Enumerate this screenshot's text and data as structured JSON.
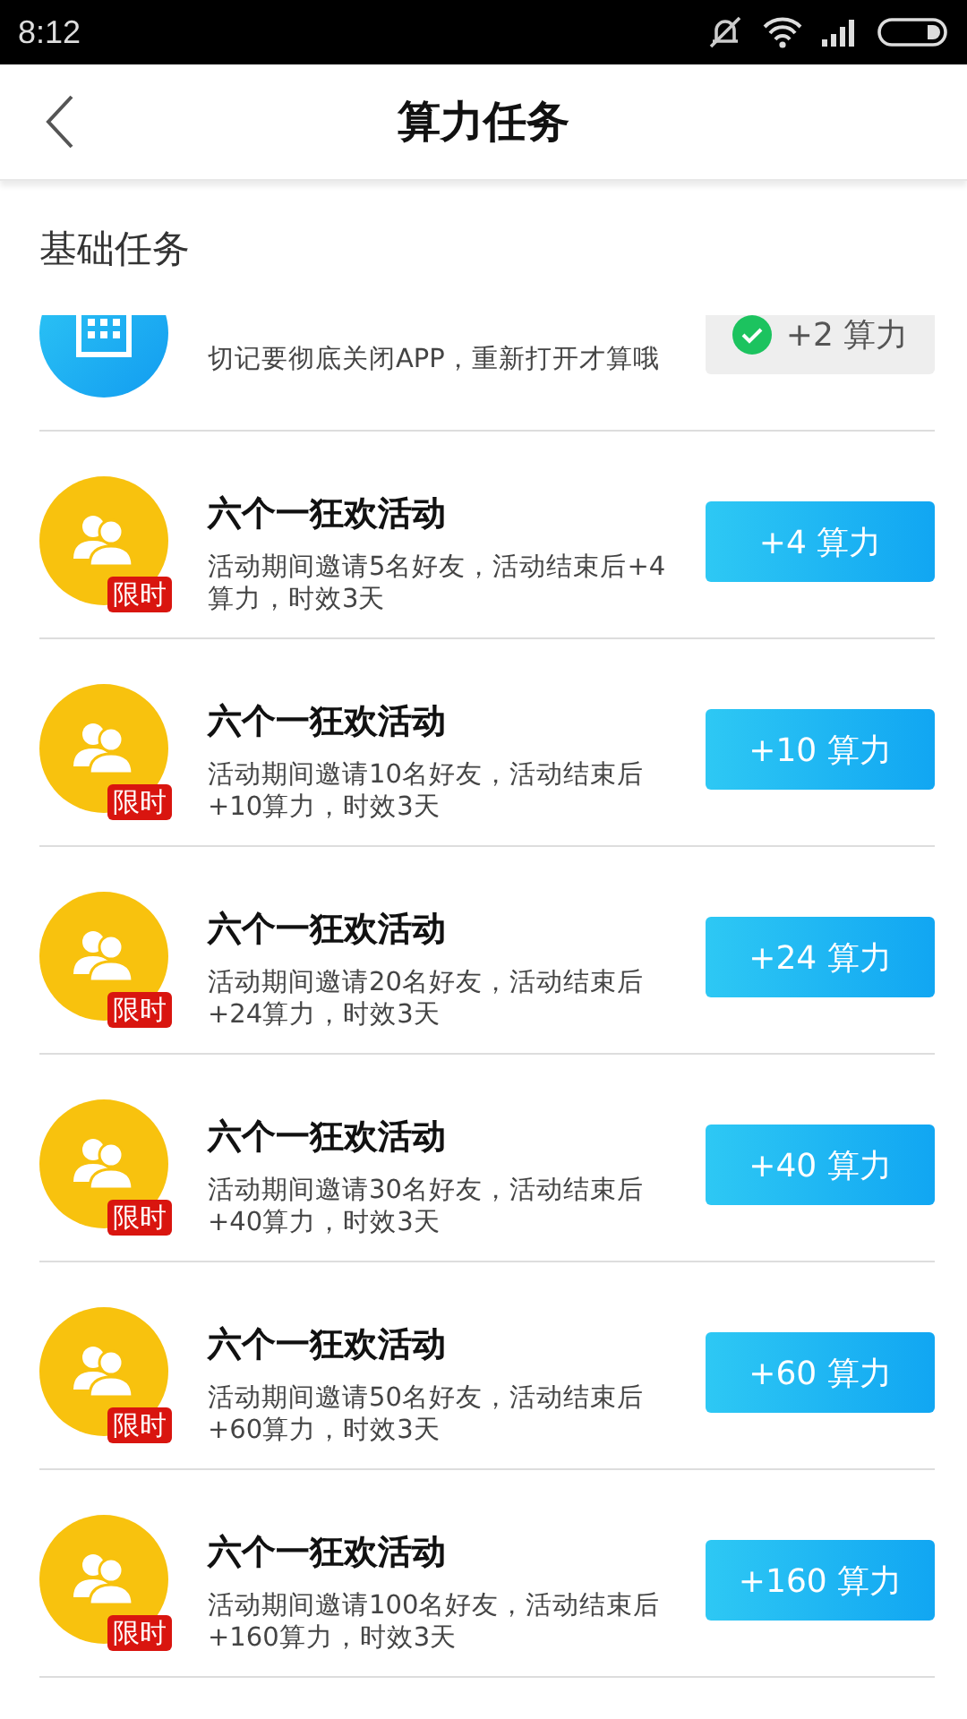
{
  "status_bar": {
    "time": "8:12"
  },
  "header": {
    "title": "算力任务"
  },
  "section": {
    "title": "基础任务"
  },
  "tasks": [
    {
      "description": "切记要彻底关闭APP，重新打开才算哦",
      "kind": "done",
      "reward": "+2 算力"
    },
    {
      "badge": "限时",
      "title": "六个一狂欢活动",
      "description": "活动期间邀请5名好友，活动结束后+4算力，时效3天",
      "kind": "claim",
      "reward": "+4 算力"
    },
    {
      "badge": "限时",
      "title": "六个一狂欢活动",
      "description": "活动期间邀请10名好友，活动结束后+10算力，时效3天",
      "kind": "claim",
      "reward": "+10 算力"
    },
    {
      "badge": "限时",
      "title": "六个一狂欢活动",
      "description": "活动期间邀请20名好友，活动结束后+24算力，时效3天",
      "kind": "claim",
      "reward": "+24 算力"
    },
    {
      "badge": "限时",
      "title": "六个一狂欢活动",
      "description": "活动期间邀请30名好友，活动结束后+40算力，时效3天",
      "kind": "claim",
      "reward": "+40 算力"
    },
    {
      "badge": "限时",
      "title": "六个一狂欢活动",
      "description": "活动期间邀请50名好友，活动结束后+60算力，时效3天",
      "kind": "claim",
      "reward": "+60 算力"
    },
    {
      "badge": "限时",
      "title": "六个一狂欢活动",
      "description": "活动期间邀请100名好友，活动结束后+160算力，时效3天",
      "kind": "claim",
      "reward": "+160 算力"
    }
  ]
}
